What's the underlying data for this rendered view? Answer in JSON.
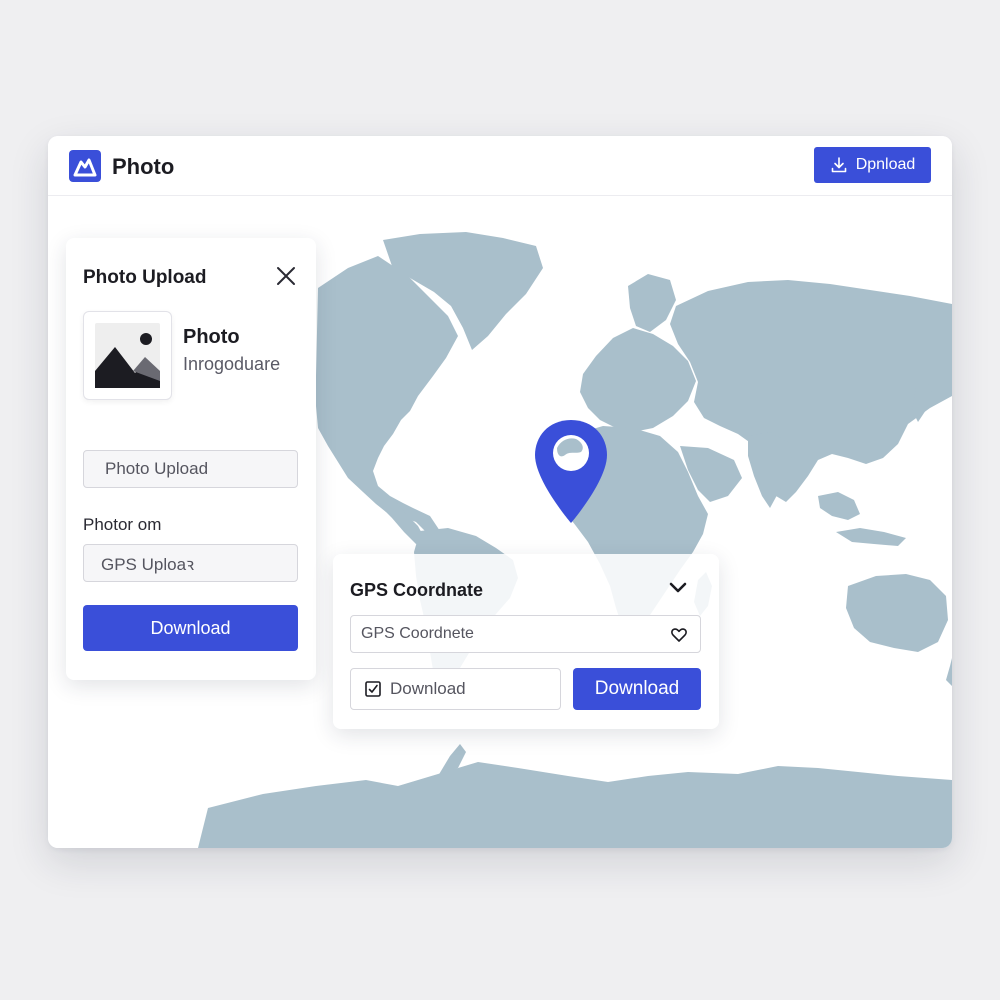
{
  "app": {
    "title": "Photo"
  },
  "header": {
    "download_label": "Dpnload"
  },
  "upload_panel": {
    "title": "Photo Upload",
    "file_name": "Photo",
    "file_subtitle": "Inrogoduare",
    "upload_field": "Photo Upload",
    "section_label": "Photor om",
    "gps_field": "GPS Uploaꝛ",
    "download_label": "Download"
  },
  "gps_panel": {
    "title": "GPS Coordnate",
    "input_value": "GPS Coordnete",
    "secondary_label": "Download",
    "primary_label": "Download"
  },
  "colors": {
    "accent": "#3a4fd9",
    "land": "#a9bfcb",
    "background": "#efeff1"
  },
  "icons": {
    "logo": "mountain-logo-icon",
    "header_button": "download-icon",
    "close": "close-icon",
    "thumbnail": "image-icon",
    "chevron": "chevron-down-icon",
    "favorite": "heart-icon",
    "checkbox": "checkbox-icon",
    "marker": "location-pin-icon"
  }
}
